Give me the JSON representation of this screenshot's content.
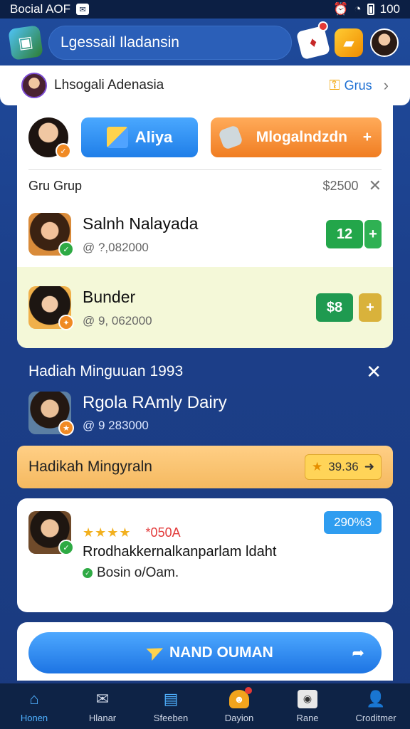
{
  "status_bar": {
    "left_text": "Bocial AOF",
    "right_text": "100"
  },
  "header": {
    "search_value": "Lgessail Iladansin"
  },
  "group_bar": {
    "title": "Lhsogali Adenasia",
    "link": "Grus"
  },
  "actions": {
    "blue_label": "Aliya",
    "orange_label": "Mlogalndzdn"
  },
  "group_row": {
    "label": "Gru Grup",
    "amount": "$2500"
  },
  "members": [
    {
      "name": "Salnh Nalayada",
      "sub": "@ ?,082000",
      "pill": "12"
    },
    {
      "name": "Bunder",
      "sub": "@ 9, 062000",
      "pill": "$8"
    }
  ],
  "weekly": {
    "heading": "Hadiah Minguuan 1993",
    "user_name": "Rgola RAmly Dairy",
    "user_sub": "@ 9 283000",
    "bar_title": "Hadikah Mingyraln",
    "bar_price": "39.36"
  },
  "review": {
    "stars": "★★★★",
    "price": "*050A",
    "tag": "290%3",
    "text": "Rrodhakkernalkanparlam ldaht",
    "status": "Bosin o/Oam."
  },
  "cta": {
    "label": "NAND OUMAN"
  },
  "bottom_nav": [
    {
      "label": "Honen",
      "icon": "home-icon"
    },
    {
      "label": "Hlanar",
      "icon": "mail-icon"
    },
    {
      "label": "Sfeeben",
      "icon": "chat-icon"
    },
    {
      "label": "Dayion",
      "icon": "game-icon"
    },
    {
      "label": "Rane",
      "icon": "camera-icon"
    },
    {
      "label": "Croditmer",
      "icon": "profile-icon"
    }
  ]
}
